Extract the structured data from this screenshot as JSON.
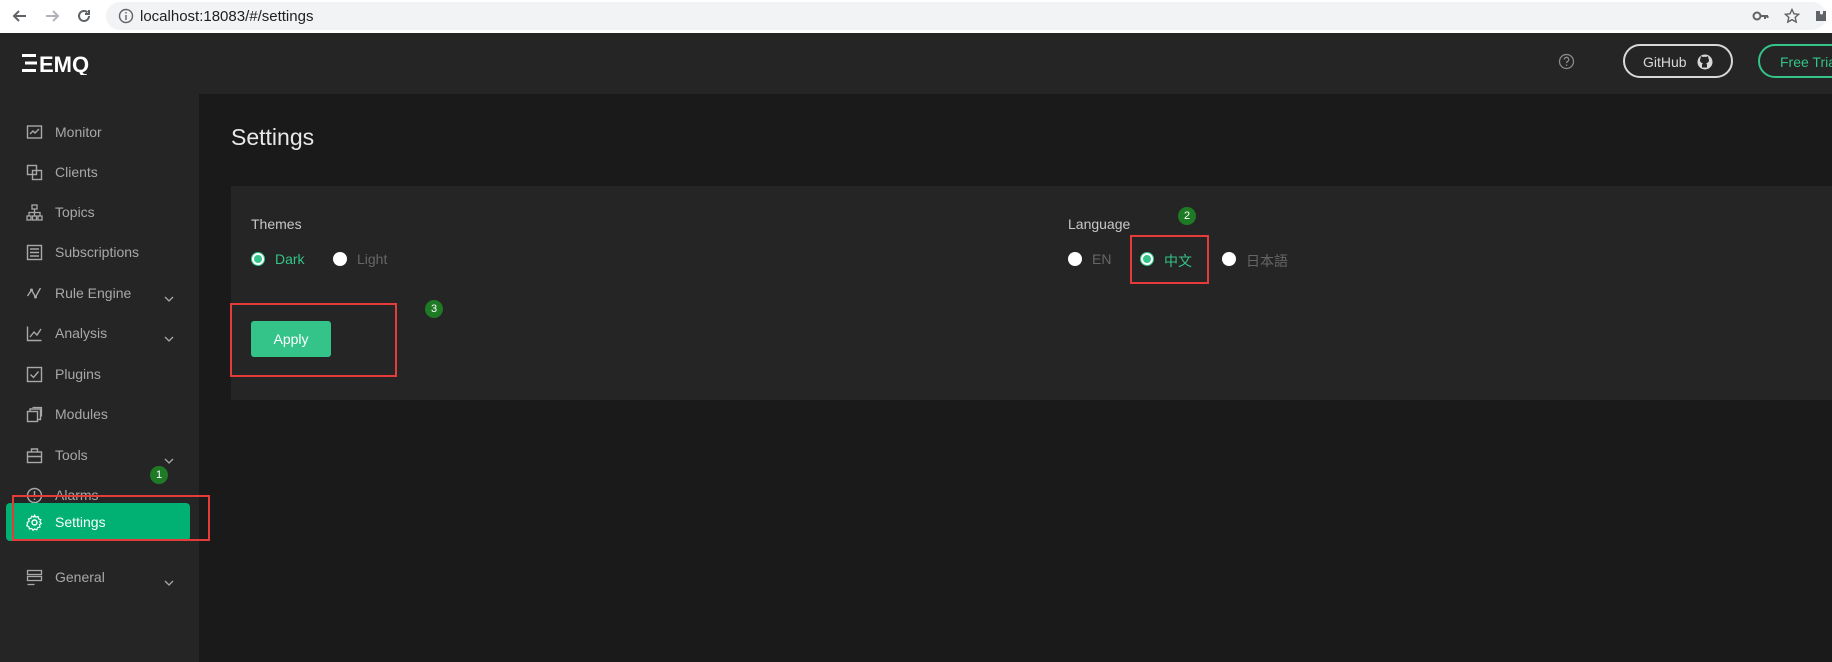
{
  "browser": {
    "url": "localhost:18083/#/settings"
  },
  "sidebar": {
    "logo": "EMQ",
    "items": [
      {
        "label": "Monitor",
        "icon": "monitor-icon"
      },
      {
        "label": "Clients",
        "icon": "clients-icon"
      },
      {
        "label": "Topics",
        "icon": "topics-icon"
      },
      {
        "label": "Subscriptions",
        "icon": "subscriptions-icon"
      },
      {
        "label": "Rule Engine",
        "icon": "rule-engine-icon",
        "expandable": true
      },
      {
        "label": "Analysis",
        "icon": "analysis-icon",
        "expandable": true
      },
      {
        "label": "Plugins",
        "icon": "plugins-icon"
      },
      {
        "label": "Modules",
        "icon": "modules-icon"
      },
      {
        "label": "Tools",
        "icon": "tools-icon",
        "expandable": true
      },
      {
        "label": "Alarms",
        "icon": "alarms-icon"
      },
      {
        "label": "Settings",
        "icon": "gear-icon",
        "active": true
      },
      {
        "label": "General",
        "icon": "general-icon",
        "expandable": true
      }
    ]
  },
  "header": {
    "github_label": "GitHub",
    "trial_label": "Free Trial"
  },
  "main": {
    "title": "Settings",
    "themes": {
      "label": "Themes",
      "options": [
        "Dark",
        "Light"
      ],
      "selected": "Dark"
    },
    "language": {
      "label": "Language",
      "options": [
        "EN",
        "中文",
        "日本語"
      ],
      "selected": "中文"
    },
    "apply_label": "Apply"
  },
  "annotations": {
    "badges": [
      "1",
      "2",
      "3"
    ],
    "box_color": "#e53b3b",
    "badge_color": "#1f7a25"
  },
  "colors": {
    "accent": "#34c388",
    "active_nav": "#00b173",
    "sidebar_bg": "#252525",
    "page_bg": "#1a1a1a"
  }
}
